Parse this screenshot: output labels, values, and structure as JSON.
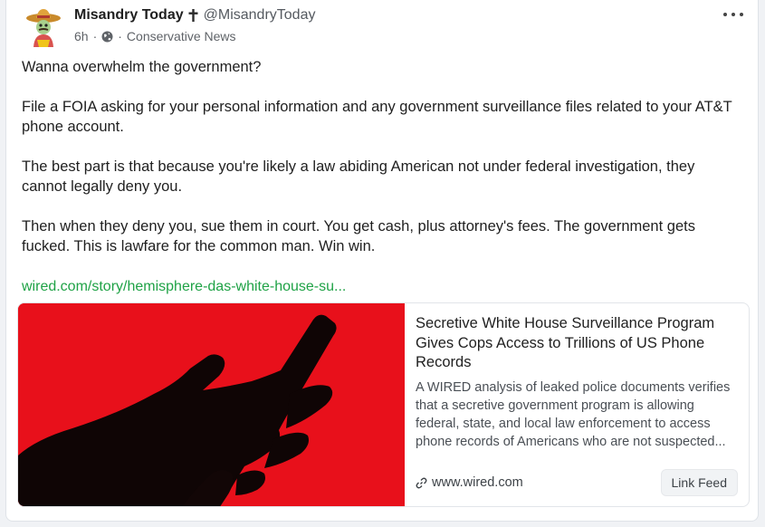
{
  "post": {
    "author_name": "Misandry Today",
    "author_handle": "@MisandryToday",
    "time_ago": "6h",
    "separator": "·",
    "community": "Conservative News",
    "icons": {
      "avatar": "cartoon-avatar-sombrero",
      "badge": "cross-icon",
      "visibility": "globe-icon",
      "more": "more-options-icon",
      "link": "link-icon"
    },
    "paragraphs": [
      "Wanna overwhelm the government?",
      "File a FOIA asking for your personal information and any government surveillance files related to your AT&T phone account.",
      "The best part is that because you're likely a law abiding American not under federal investigation, they cannot legally deny you.",
      "Then when they deny you, sue them in court. You get cash, plus attorney's fees. The government gets fucked. This is lawfare for the common man. Win win."
    ],
    "link_text": "wired.com/story/hemisphere-das-white-house-su...",
    "link_color": "#1fa246"
  },
  "link_preview": {
    "title": "Secretive White House Surveillance Program Gives Cops Access to Trillions of US Phone Records",
    "description": "A WIRED analysis of leaked police documents verifies that a secretive government program is allowing federal, state, and local law enforcement to access phone records of Americans who are not suspected...",
    "domain": "www.wired.com",
    "feed_button_label": "Link Feed",
    "image_background": "#e8101b"
  }
}
